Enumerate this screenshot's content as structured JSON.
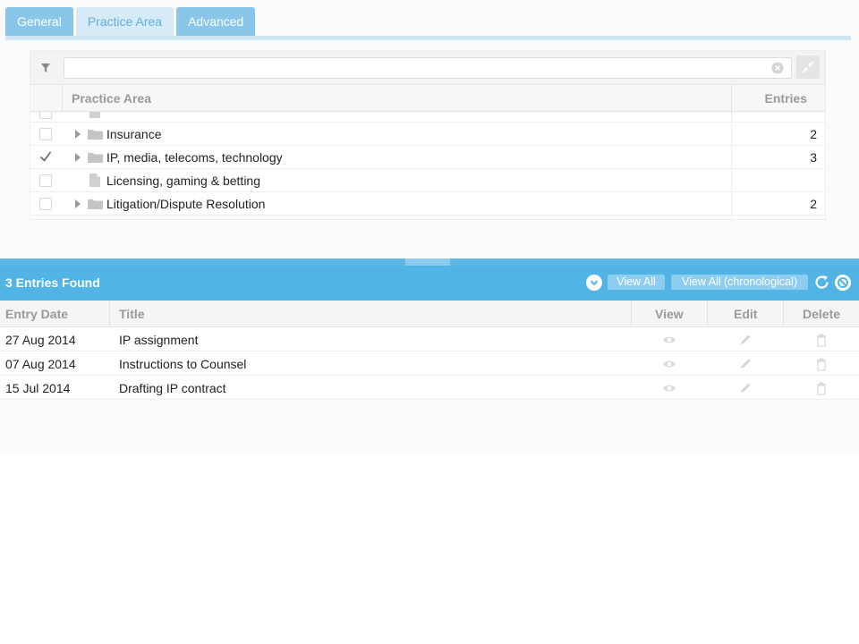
{
  "tabs": [
    {
      "label": "General"
    },
    {
      "label": "Practice Area"
    },
    {
      "label": "Advanced"
    }
  ],
  "practice_area": {
    "filter": {
      "value": "",
      "placeholder": ""
    },
    "columns": {
      "area": "Practice Area",
      "entries": "Entries"
    },
    "rows": [
      {
        "label": "Insurance",
        "entries": "2",
        "checked": false,
        "type": "folder",
        "expandable": true
      },
      {
        "label": "IP, media, telecoms, technology",
        "entries": "3",
        "checked": true,
        "type": "folder",
        "expandable": true
      },
      {
        "label": "Licensing, gaming & betting",
        "entries": "",
        "checked": false,
        "type": "document",
        "expandable": false
      },
      {
        "label": "Litigation/Dispute Resolution",
        "entries": "2",
        "checked": false,
        "type": "folder",
        "expandable": true
      }
    ]
  },
  "results": {
    "title": "3 Entries Found",
    "view_all": "View All",
    "view_all_chron": "View All (chronological)",
    "columns": {
      "date": "Entry Date",
      "title": "Title",
      "view": "View",
      "edit": "Edit",
      "delete": "Delete"
    },
    "rows": [
      {
        "date": "27 Aug 2014",
        "title": "IP assignment"
      },
      {
        "date": "07 Aug 2014",
        "title": "Instructions to Counsel"
      },
      {
        "date": "15 Jul 2014",
        "title": "Drafting IP contract"
      }
    ]
  },
  "colors": {
    "accent": "#52b4e5",
    "tab": "#8ac6e8",
    "tab_light": "#d6ebf7"
  }
}
